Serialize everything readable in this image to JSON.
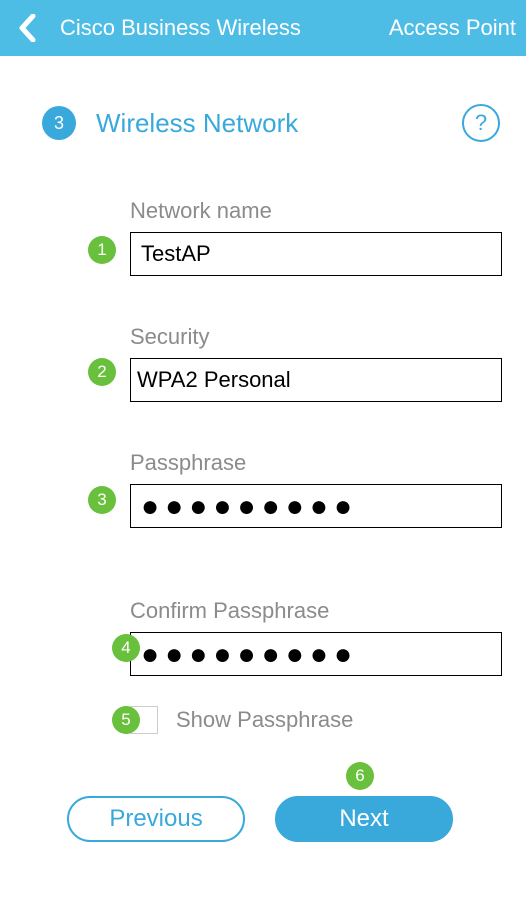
{
  "header": {
    "title": "Cisco Business Wireless",
    "right": "Access Point"
  },
  "step": {
    "number": "3",
    "title": "Wireless Network",
    "help": "?"
  },
  "fields": {
    "network_name": {
      "label": "Network name",
      "value": "TestAP"
    },
    "security": {
      "label": "Security",
      "value": "WPA2 Personal"
    },
    "passphrase": {
      "label": "Passphrase",
      "mask": "●●●●●●●●●"
    },
    "confirm": {
      "label": "Confirm Passphrase",
      "mask": "●●●●●●●●●"
    },
    "show_passphrase": {
      "label": "Show Passphrase",
      "checked": false
    }
  },
  "annotations": {
    "a1": "1",
    "a2": "2",
    "a3": "3",
    "a4": "4",
    "a5": "5",
    "a6": "6"
  },
  "buttons": {
    "previous": "Previous",
    "next": "Next"
  }
}
